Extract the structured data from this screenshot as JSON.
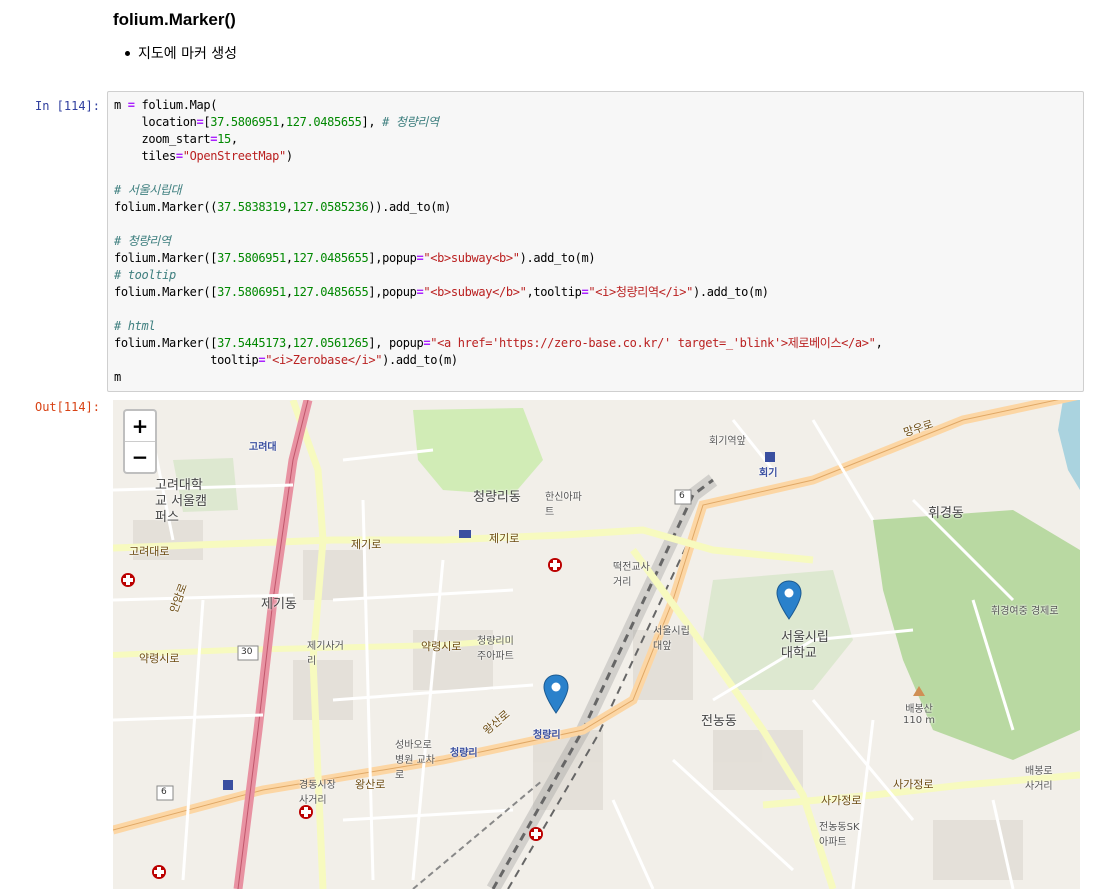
{
  "markdown": {
    "title": "folium.Marker()",
    "bullets": [
      "지도에 마커 생성"
    ]
  },
  "prompts": {
    "in": "In [114]:",
    "out": "Out[114]:"
  },
  "code": {
    "l1": {
      "a": "m ",
      "op": "=",
      "b": " folium.Map("
    },
    "l2": {
      "a": "    location",
      "op": "=",
      "b": "[",
      "n1": "37.5806951",
      "c": ",",
      "n2": "127.0485655",
      "d": "], ",
      "com": "# 청량리역"
    },
    "l3": {
      "a": "    zoom_start",
      "op": "=",
      "n": "15",
      "b": ","
    },
    "l4": {
      "a": "    tiles",
      "op": "=",
      "s": "\"OpenStreetMap\"",
      "b": ")"
    },
    "l6": {
      "com": "# 서울시립대"
    },
    "l7": {
      "a": "folium.Marker((",
      "n1": "37.5838319",
      "c": ",",
      "n2": "127.0585236",
      "b": ")).add_to(m)"
    },
    "l9": {
      "com": "# 청량리역"
    },
    "l10": {
      "a": "folium.Marker([",
      "n1": "37.5806951",
      "c": ",",
      "n2": "127.0485655",
      "b": "],popup",
      "op": "=",
      "s": "\"<b>subway<b>\"",
      "d": ").add_to(m)"
    },
    "l11": {
      "com": "# tooltip"
    },
    "l12": {
      "a": "folium.Marker([",
      "n1": "37.5806951",
      "c": ",",
      "n2": "127.0485655",
      "b": "],popup",
      "op": "=",
      "s": "\"<b>subway</b>\"",
      "d": ",tooltip",
      "op2": "=",
      "s2": "\"<i>청량리역</i>\"",
      "e": ").add_to(m)"
    },
    "l14": {
      "com": "# html"
    },
    "l15": {
      "a": "folium.Marker([",
      "n1": "37.5445173",
      "c": ",",
      "n2": "127.0561265",
      "b": "], popup",
      "op": "=",
      "s": "\"<a href='https://zero-base.co.kr/' target=_'blink'>제로베이스</a>\"",
      "d": ","
    },
    "l16": {
      "a": "              tooltip",
      "op": "=",
      "s": "\"<i>Zerobase</i>\"",
      "b": ").add_to(m)"
    },
    "l17": {
      "a": "m"
    }
  },
  "map": {
    "zoom_in": "+",
    "zoom_out": "−",
    "labels": {
      "korea_univ": "고려대",
      "korea_univ_campus": "고려대학\n교 서울캠\n퍼스",
      "korea_univ_st": "고려대로",
      "anam": "안암로",
      "cheongnyang_dong": "청량리동",
      "hansin_apt": "한신아파\n트",
      "hoegi_st": "회기",
      "hoegi_yeokro": "회기역앞",
      "hwigyeong": "휘경동",
      "mangu_ro": "망우로",
      "jegi_ro": "제기로",
      "jegi_dong": "제기동",
      "jegi_crossing": "제기사거\n리",
      "yangnyeong_ro": "약령시로",
      "cheongnyangri_apt": "청량리미\n주아파트",
      "wangsan_ro": "왕산로",
      "cheongnyangri": "청량리",
      "cheongnyangri_st": "청량리",
      "seoul_univ": "서울시립\n대학교",
      "seoul_univ_front": "서울시립\n대앞",
      "ddeokjeon": "떡전교사\n거리",
      "jeonnong": "전농동",
      "baebongsan": "배봉산\n110 m",
      "sagajeong": "사가정로",
      "gyeongdong": "경동시장\n사거리",
      "seongbaro": "성바오로\n병원 교차\n로",
      "hwigyeong_girls": "휘경여중 경제로",
      "baebong_crossing": "배봉로\n사거리",
      "jeonnong_sk": "전농동SK\n아파트",
      "route_6a": "6",
      "route_6b": "6",
      "route_30": "30"
    },
    "markers": [
      {
        "name": "서울시립대",
        "lat": 37.5838319,
        "lng": 127.0585236
      },
      {
        "name": "청량리역",
        "lat": 37.5806951,
        "lng": 127.0485655
      }
    ],
    "colors": {
      "marker": "#2a81cb",
      "water": "#aad3df",
      "park": "#c8e5a8",
      "rail": "#777777",
      "primary": "#fcd6a4",
      "motorway": "#e892a2",
      "secondary": "#f7fabf"
    }
  }
}
